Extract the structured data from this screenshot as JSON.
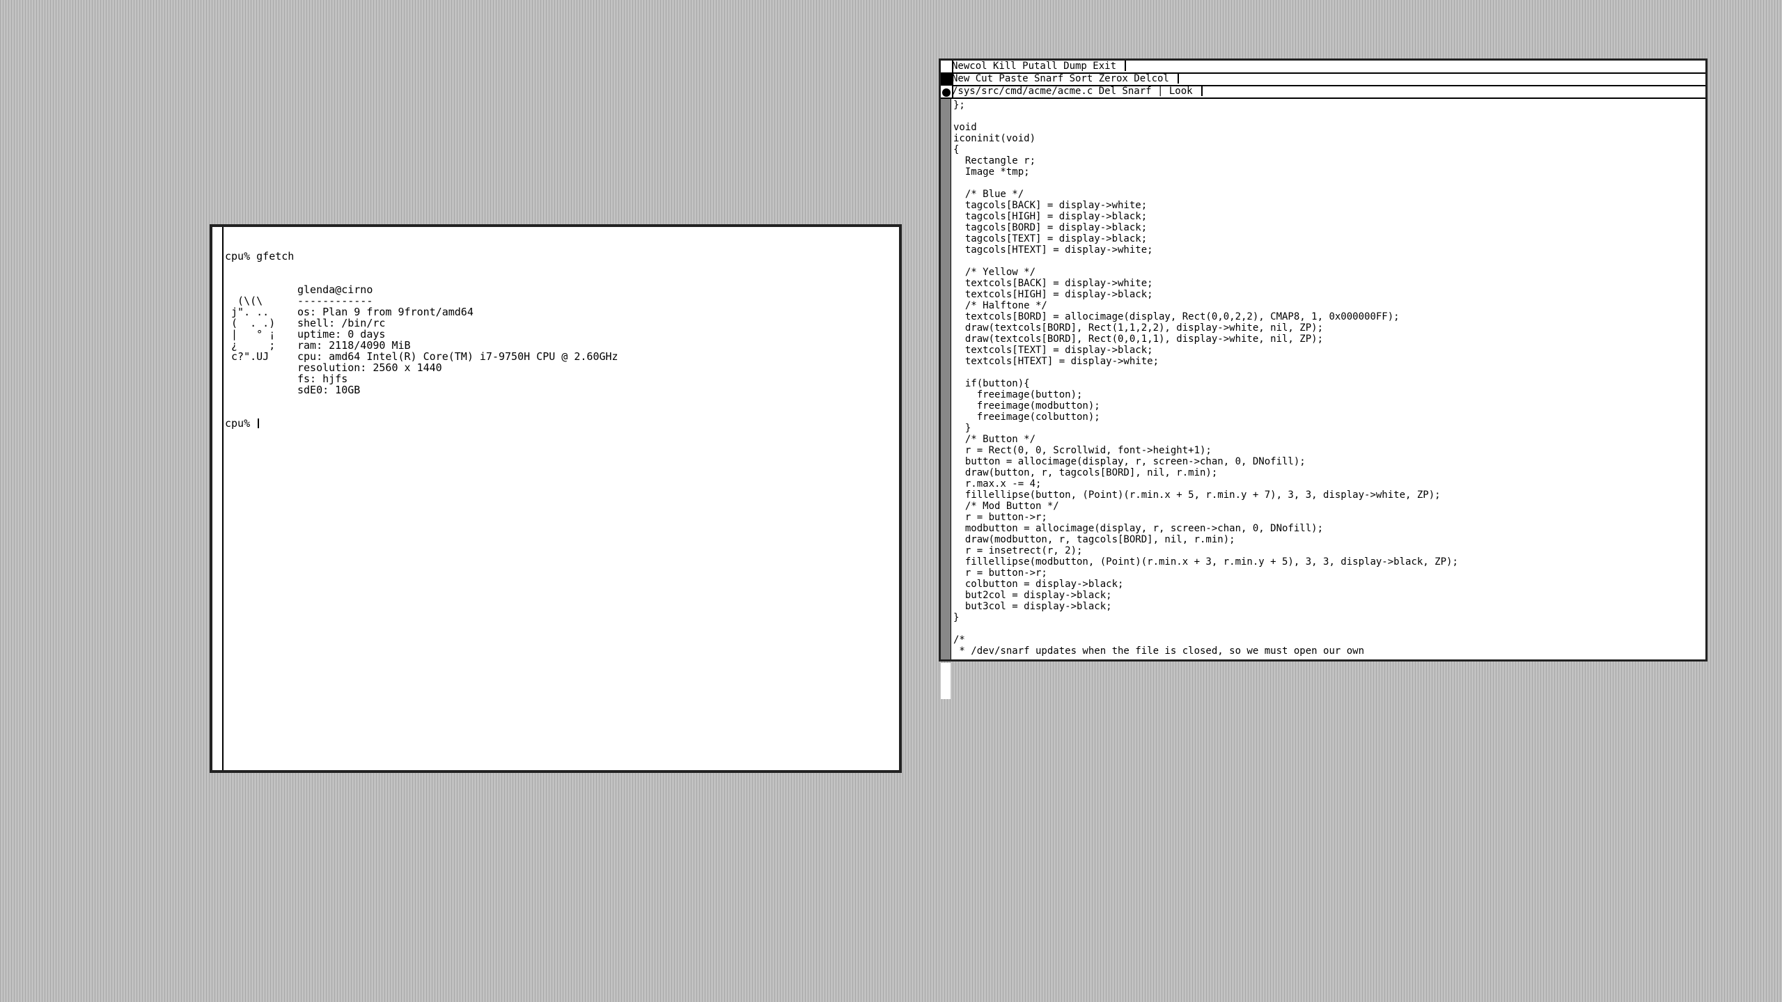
{
  "terminal": {
    "command_line": "cpu% gfetch",
    "logo": [
      "",
      "  (\\(\\",
      " j\". ..",
      " (  . .)",
      " |   ° ¡",
      " ¿     ;",
      " c?\".UJ",
      "",
      "",
      ""
    ],
    "info": [
      "glenda@cirno",
      "------------",
      "os: Plan 9 from 9front/amd64",
      "shell: /bin/rc",
      "uptime: 0 days",
      "ram: 2118/4090 MiB",
      "cpu: amd64 Intel(R) Core(TM) i7-9750H CPU @ 2.60GHz",
      "resolution: 2560 x 1440",
      "fs: hjfs",
      "sdE0: 10GB"
    ],
    "prompt": "cpu% "
  },
  "acme": {
    "main_tag": "Newcol Kill Putall Dump Exit ",
    "column_tag": "New Cut Paste Snarf Sort Zerox Delcol ",
    "file_tag": "/sys/src/cmd/acme/acme.c Del Snarf | Look ",
    "code_lines": [
      "};",
      "",
      "void",
      "iconinit(void)",
      "{",
      "  Rectangle r;",
      "  Image *tmp;",
      "",
      "  /* Blue */",
      "  tagcols[BACK] = display->white;",
      "  tagcols[HIGH] = display->black;",
      "  tagcols[BORD] = display->black;",
      "  tagcols[TEXT] = display->black;",
      "  tagcols[HTEXT] = display->white;",
      "",
      "  /* Yellow */",
      "  textcols[BACK] = display->white;",
      "  textcols[HIGH] = display->black;",
      "  /* Halftone */",
      "  textcols[BORD] = allocimage(display, Rect(0,0,2,2), CMAP8, 1, 0x000000FF);",
      "  draw(textcols[BORD], Rect(1,1,2,2), display->white, nil, ZP);",
      "  draw(textcols[BORD], Rect(0,0,1,1), display->white, nil, ZP);",
      "  textcols[TEXT] = display->black;",
      "  textcols[HTEXT] = display->white;",
      "",
      "  if(button){",
      "    freeimage(button);",
      "    freeimage(modbutton);",
      "    freeimage(colbutton);",
      "  }",
      "  /* Button */",
      "  r = Rect(0, 0, Scrollwid, font->height+1);",
      "  button = allocimage(display, r, screen->chan, 0, DNofill);",
      "  draw(button, r, tagcols[BORD], nil, r.min);",
      "  r.max.x -= 4;",
      "  fillellipse(button, (Point)(r.min.x + 5, r.min.y + 7), 3, 3, display->white, ZP);",
      "  /* Mod Button */",
      "  r = button->r;",
      "  modbutton = allocimage(display, r, screen->chan, 0, DNofill);",
      "  draw(modbutton, r, tagcols[BORD], nil, r.min);",
      "  r = insetrect(r, 2);",
      "  fillellipse(modbutton, (Point)(r.min.x + 3, r.min.y + 5), 3, 3, display->black, ZP);",
      "  r = button->r;",
      "  colbutton = display->black;",
      "  but2col = display->black;",
      "  but3col = display->black;",
      "}",
      "",
      "/*",
      " * /dev/snarf updates when the file is closed, so we must open our own"
    ]
  }
}
